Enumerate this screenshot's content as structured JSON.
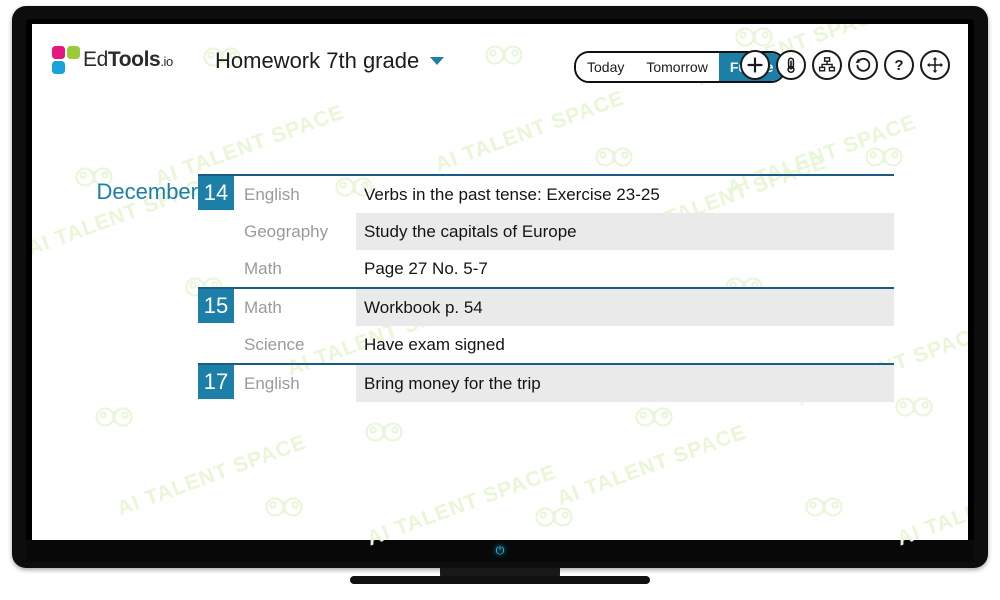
{
  "app": {
    "logo_name_prefix": "Ed",
    "logo_name_bold": "Tools",
    "logo_name_suffix": ".io",
    "document_title": "Homework 7th grade",
    "dropdown_icon": "chevron-down-icon",
    "accent_color": "#1b7fa8",
    "rule_color": "#1b5c86",
    "row_shade_color": "#eaeaea",
    "logo_colors": {
      "pink": "#e6187f",
      "green": "#9bcb3b",
      "blue": "#19a3dd"
    }
  },
  "view_switch": {
    "options": [
      "Today",
      "Tomorrow",
      "Future"
    ],
    "selected": "Future"
  },
  "toolbar": {
    "buttons": [
      {
        "name": "plus-icon",
        "label": "Add"
      },
      {
        "name": "thermometer-icon",
        "label": "Temperature"
      },
      {
        "name": "sitemap-icon",
        "label": "Structure"
      },
      {
        "name": "undo-icon",
        "label": "Undo"
      },
      {
        "name": "question-mark-icon",
        "label": "Help"
      },
      {
        "name": "move-arrows-icon",
        "label": "Move"
      }
    ]
  },
  "board": {
    "month": "December",
    "groups": [
      {
        "day": "14",
        "show_month": true,
        "entries": [
          {
            "subject": "English",
            "task": "Verbs in the past tense: Exercise 23-25",
            "shaded": false
          },
          {
            "subject": "Geography",
            "task": "Study the capitals of Europe",
            "shaded": true
          },
          {
            "subject": "Math",
            "task": "Page 27 No. 5-7",
            "shaded": false
          }
        ]
      },
      {
        "day": "15",
        "show_month": false,
        "entries": [
          {
            "subject": "Math",
            "task": "Workbook p. 54",
            "shaded": true
          },
          {
            "subject": "Science",
            "task": "Have exam signed",
            "shaded": false
          }
        ]
      },
      {
        "day": "17",
        "show_month": false,
        "entries": [
          {
            "subject": "English",
            "task": "Bring money for the trip",
            "shaded": true
          }
        ]
      }
    ]
  },
  "hardware": {
    "power_glyph": "⏻"
  },
  "watermark": {
    "text": "AI TALENT SPACE"
  }
}
